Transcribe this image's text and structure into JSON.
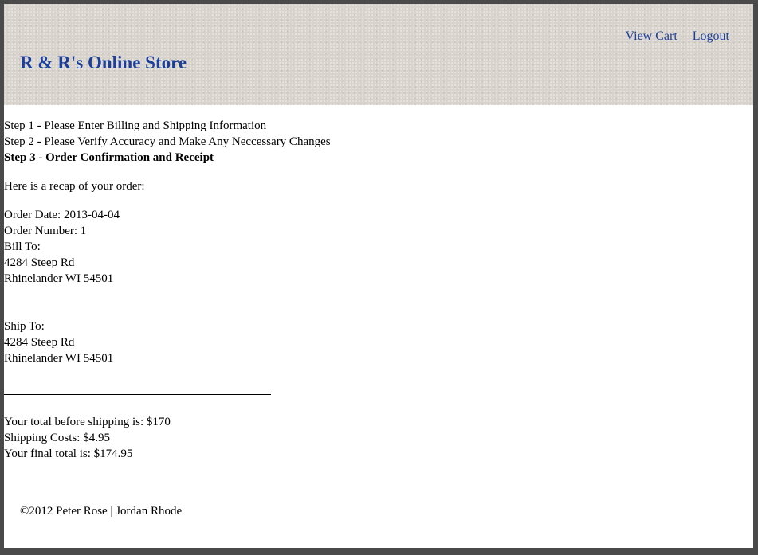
{
  "header": {
    "title": "R & R's Online Store",
    "nav": [
      "View Cart",
      "Logout"
    ]
  },
  "steps": {
    "step1": "Step 1 - Please Enter Billing and Shipping Information",
    "step2": "Step 2 - Please Verify Accuracy and Make Any Neccessary Changes",
    "step3": "Step 3 - Order Confirmation and Receipt"
  },
  "recap_intro": "Here is a recap of your order:",
  "order": {
    "date": "Order Date: 2013-04-04",
    "number": "Order Number: 1",
    "bill_to_label": "Bill To:",
    "bill_to_street": "4284 Steep Rd",
    "bill_to_city": "Rhinelander WI 54501",
    "ship_to_label": "Ship To:",
    "ship_to_street": "4284 Steep Rd",
    "ship_to_city": "Rhinelander WI 54501"
  },
  "totals": {
    "subtotal": "Your total before shipping is: $170",
    "shipping": "Shipping Costs: $4.95",
    "final": "Your final total is: $174.95"
  },
  "footer": {
    "copyright": "©2012 Peter Rose | Jordan Rhode"
  },
  "colors": {
    "link": "#1c3f9c",
    "header_bg": "#d8d4cd",
    "frame_border": "#4a4a4a"
  }
}
